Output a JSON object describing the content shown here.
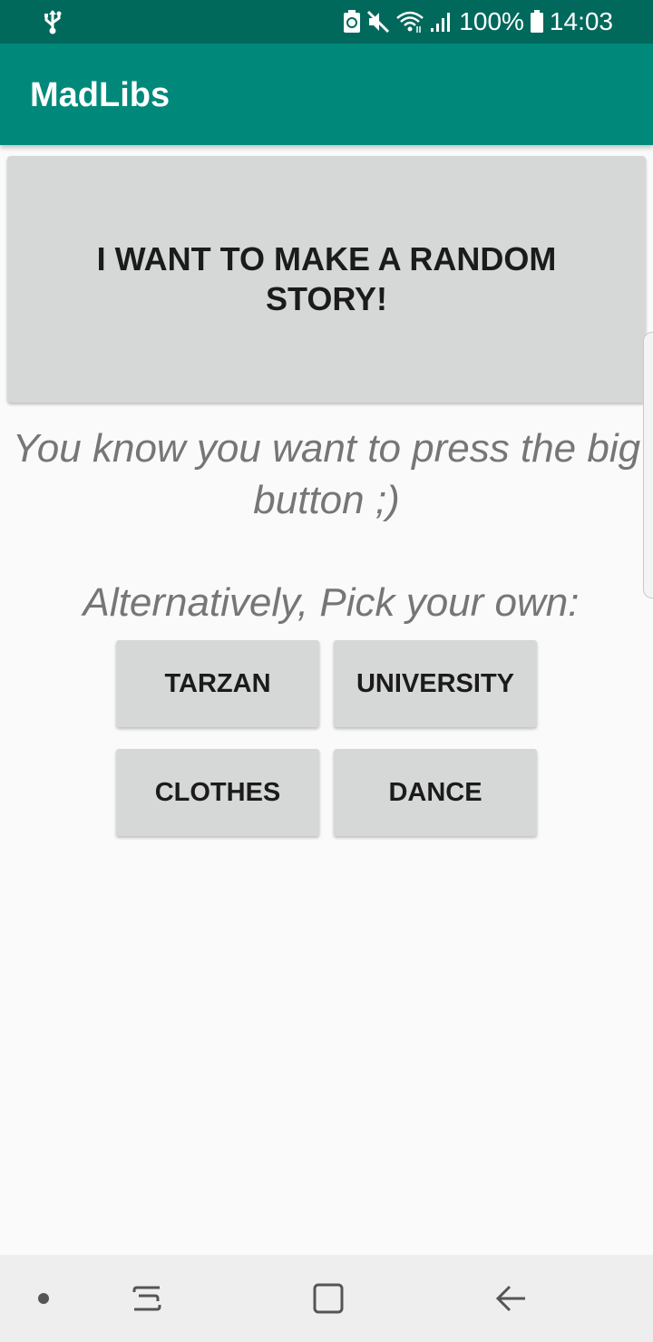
{
  "status_bar": {
    "battery_percent": "100%",
    "time": "14:03",
    "icons": [
      "usb-icon",
      "battery-saver-icon",
      "mute-icon",
      "wifi-icon",
      "signal-icon",
      "battery-icon"
    ]
  },
  "app_bar": {
    "title": "MadLibs"
  },
  "main": {
    "random_button_label": "I WANT TO MAKE A RANDOM STORY!",
    "tagline": "You know you want to press the big button ;)",
    "alternative_heading": "Alternatively, Pick your own:",
    "stories": [
      {
        "label": "TARZAN"
      },
      {
        "label": "UNIVERSITY"
      },
      {
        "label": "CLOTHES"
      },
      {
        "label": "DANCE"
      }
    ]
  },
  "nav_bar": {
    "icons": [
      "dot-icon",
      "recent-apps-icon",
      "home-icon",
      "back-icon"
    ]
  },
  "colors": {
    "status_bar": "#00695c",
    "app_bar": "#00897b",
    "button": "#d6d7d7",
    "secondary_text": "#767676",
    "background": "#fafafa"
  }
}
